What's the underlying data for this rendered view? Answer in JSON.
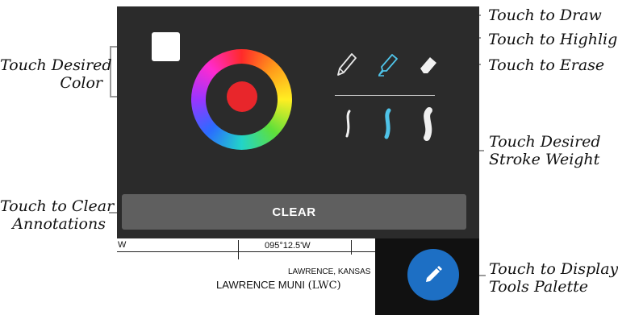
{
  "callouts": {
    "draw": "Touch to Draw",
    "highlight": "Touch to Highlight",
    "erase": "Touch to Erase",
    "color_line1": "Touch Desired",
    "color_line2": "Color",
    "stroke_line1": "Touch Desired",
    "stroke_line2": "Stroke Weight",
    "clear_line1": "Touch to Clear",
    "clear_line2": "Annotations",
    "display_line1": "Touch to Display",
    "display_line2": "Tools Palette"
  },
  "palette": {
    "clear_label": "CLEAR",
    "selected_color": "#ffffff",
    "active_color": "#e8262b",
    "highlight_accent": "#4fc3e8",
    "background": "#2b2b2b"
  },
  "tools": [
    {
      "name": "pencil-icon",
      "active": false
    },
    {
      "name": "highlighter-icon",
      "active": true
    },
    {
      "name": "eraser-icon",
      "active": false
    }
  ],
  "strokes": [
    "thin",
    "medium",
    "thick"
  ],
  "chart": {
    "left_coord": "W",
    "coordinate": "095°12.5'W",
    "city": "LAWRENCE, KANSAS",
    "airport": "LAWRENCE MUNI",
    "airport_code": "(LWC)"
  },
  "fab": {
    "icon": "pencil-icon",
    "color": "#1d6fc4"
  }
}
